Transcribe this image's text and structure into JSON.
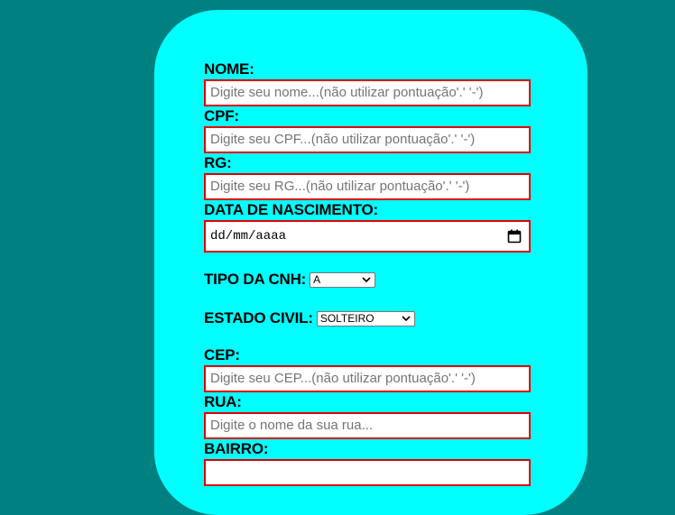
{
  "form": {
    "nome": {
      "label": "NOME:",
      "placeholder": "Digite seu nome...(não utilizar pontuação'.' '-')"
    },
    "cpf": {
      "label": "CPF:",
      "placeholder": "Digite seu CPF...(não utilizar pontuação'.' '-')"
    },
    "rg": {
      "label": "RG:",
      "placeholder": "Digite seu RG...(não utilizar pontuação'.' '-')"
    },
    "nascimento": {
      "label": "DATA DE NASCIMENTO:",
      "value": "dd/mm/aaaa"
    },
    "cnh": {
      "label": "TIPO DA CNH:",
      "selected": "A"
    },
    "estado_civil": {
      "label": "ESTADO CIVIL:",
      "selected": "SOLTEIRO"
    },
    "cep": {
      "label": "CEP:",
      "placeholder": "Digite seu CEP...(não utilizar pontuação'.' '-')"
    },
    "rua": {
      "label": "RUA:",
      "placeholder": "Digite o nome da sua rua..."
    },
    "bairro": {
      "label": "BAIRRO:"
    }
  },
  "colors": {
    "background": "#008080",
    "card": "#00ffff",
    "field_border": "#e00000"
  },
  "icons": {
    "date": "calendar-icon",
    "select": "chevron-down-icon"
  }
}
